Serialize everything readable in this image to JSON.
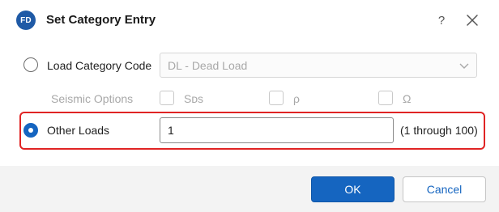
{
  "window": {
    "title": "Set Category Entry",
    "app_logo_text": "FD",
    "help_label": "?"
  },
  "load_category": {
    "radio_label": "Load Category Code",
    "selected": false,
    "dropdown_value": "DL - Dead Load"
  },
  "seismic": {
    "label": "Seismic Options",
    "options": [
      {
        "label": "Sᴅs",
        "checked": false
      },
      {
        "label": "ρ",
        "checked": false
      },
      {
        "label": "Ω",
        "checked": false
      }
    ]
  },
  "other_loads": {
    "radio_label": "Other Loads",
    "selected": true,
    "value": "1",
    "range_hint": "(1 through 100)"
  },
  "buttons": {
    "ok_label": "OK",
    "cancel_label": "Cancel"
  },
  "colors": {
    "accent": "#1565c0",
    "highlight": "#e02424",
    "logo": "#1f5aa6"
  }
}
